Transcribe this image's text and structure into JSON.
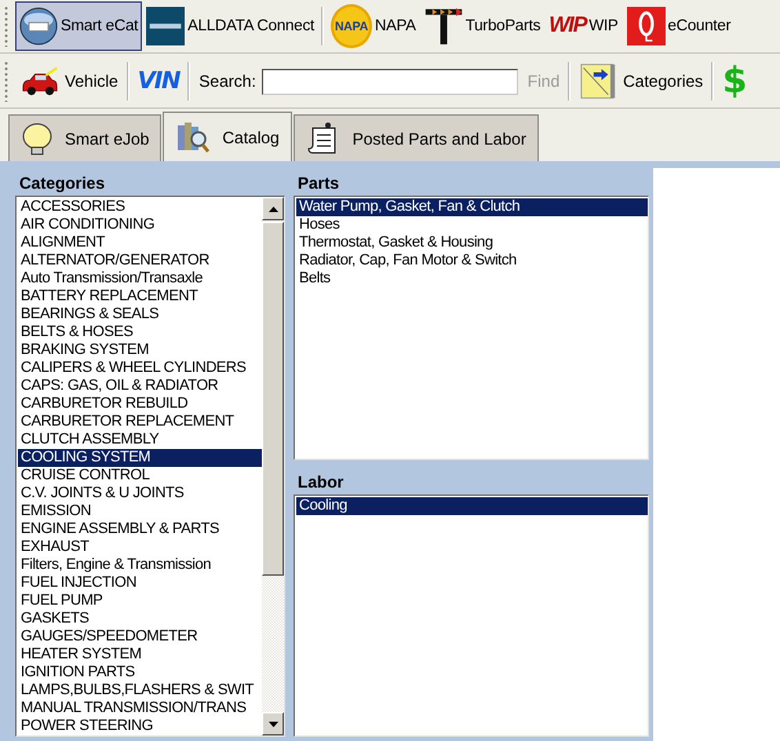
{
  "toolbar": [
    {
      "kind": "ecat",
      "label": "Smart eCat",
      "selected": true
    },
    {
      "kind": "alldata",
      "label": "ALLDATA Connect",
      "selected": false
    },
    {
      "kind": "napa",
      "label": "NAPA",
      "logo_text": "NAPA",
      "selected": false
    },
    {
      "kind": "turbo",
      "label": "TurboParts",
      "selected": false
    },
    {
      "kind": "wip",
      "label": "WIP",
      "logo_text": "WIP",
      "selected": false
    },
    {
      "kind": "ecounter",
      "label": "eCounter",
      "selected": false
    }
  ],
  "search_bar": {
    "vehicle_label": "Vehicle",
    "vin_label": "VIN",
    "search_label": "Search:",
    "find_label": "Find",
    "find_disabled": true,
    "categories_label": "Categories",
    "dollar_label": "$"
  },
  "tabs": [
    {
      "kind": "bulb",
      "label": "Smart eJob",
      "selected": false
    },
    {
      "kind": "catalog",
      "label": "Catalog",
      "selected": true
    },
    {
      "kind": "note",
      "label": "Posted Parts and Labor",
      "selected": false
    }
  ],
  "categories": {
    "title": "Categories",
    "items": [
      {
        "label": "ACCESSORIES",
        "selected": false
      },
      {
        "label": "AIR CONDITIONING",
        "selected": false
      },
      {
        "label": "ALIGNMENT",
        "selected": false
      },
      {
        "label": "ALTERNATOR/GENERATOR",
        "selected": false
      },
      {
        "label": "Auto Transmission/Transaxle",
        "selected": false
      },
      {
        "label": "BATTERY REPLACEMENT",
        "selected": false
      },
      {
        "label": "BEARINGS & SEALS",
        "selected": false
      },
      {
        "label": "BELTS & HOSES",
        "selected": false
      },
      {
        "label": "BRAKING SYSTEM",
        "selected": false
      },
      {
        "label": "CALIPERS & WHEEL CYLINDERS",
        "selected": false
      },
      {
        "label": "CAPS: GAS, OIL & RADIATOR",
        "selected": false
      },
      {
        "label": "CARBURETOR REBUILD",
        "selected": false
      },
      {
        "label": "CARBURETOR REPLACEMENT",
        "selected": false
      },
      {
        "label": "CLUTCH ASSEMBLY",
        "selected": false
      },
      {
        "label": "COOLING SYSTEM",
        "selected": true
      },
      {
        "label": "CRUISE CONTROL",
        "selected": false
      },
      {
        "label": "C.V. JOINTS & U JOINTS",
        "selected": false
      },
      {
        "label": "EMISSION",
        "selected": false
      },
      {
        "label": "ENGINE ASSEMBLY & PARTS",
        "selected": false
      },
      {
        "label": "EXHAUST",
        "selected": false
      },
      {
        "label": "Filters, Engine & Transmission",
        "selected": false
      },
      {
        "label": "FUEL INJECTION",
        "selected": false
      },
      {
        "label": "FUEL PUMP",
        "selected": false
      },
      {
        "label": "GASKETS",
        "selected": false
      },
      {
        "label": "GAUGES/SPEEDOMETER",
        "selected": false
      },
      {
        "label": "HEATER SYSTEM",
        "selected": false
      },
      {
        "label": "IGNITION PARTS",
        "selected": false
      },
      {
        "label": "LAMPS,BULBS,FLASHERS & SWIT",
        "selected": false
      },
      {
        "label": "MANUAL TRANSMISSION/TRANS",
        "selected": false
      },
      {
        "label": "POWER STEERING",
        "selected": false
      }
    ]
  },
  "parts": {
    "title": "Parts",
    "items": [
      {
        "label": "Water Pump, Gasket, Fan & Clutch",
        "selected": true
      },
      {
        "label": "Hoses",
        "selected": false
      },
      {
        "label": "Thermostat, Gasket & Housing",
        "selected": false
      },
      {
        "label": "Radiator, Cap, Fan Motor & Switch",
        "selected": false
      },
      {
        "label": "Belts",
        "selected": false
      }
    ]
  },
  "labor": {
    "title": "Labor",
    "items": [
      {
        "label": "Cooling",
        "selected": true
      }
    ]
  }
}
